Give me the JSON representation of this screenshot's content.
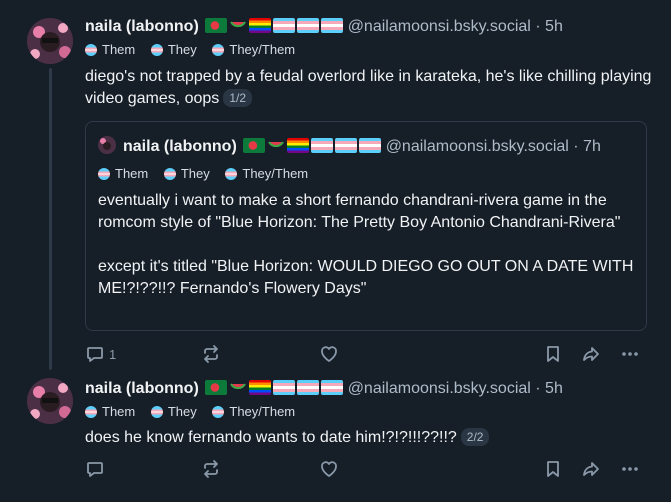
{
  "posts": [
    {
      "author_name": "naila (labonno)",
      "handle": "@nailamoonsi.bsky.social",
      "time": "· 5h",
      "pronouns": [
        "Them",
        "They",
        "They/Them"
      ],
      "text": "diego's not trapped by a feudal overlord like in karateka, he's like chilling playing video games, oops",
      "thread_badge": "1/2",
      "quote": {
        "author_name": "naila (labonno)",
        "handle": "@nailamoonsi.bsky.social",
        "time": "· 7h",
        "pronouns": [
          "Them",
          "They",
          "They/Them"
        ],
        "text_p1": "eventually i want to make a short fernando chandrani-rivera game in the romcom style of \"Blue Horizon: The Pretty Boy Antonio Chandrani-Rivera\"",
        "text_p2": "except it's titled \"Blue Horizon: WOULD DIEGO GO OUT ON A DATE WITH ME!?!??!!? Fernando's Flowery Days\""
      },
      "reply_count": "1"
    },
    {
      "author_name": "naila (labonno)",
      "handle": "@nailamoonsi.bsky.social",
      "time": "· 5h",
      "pronouns": [
        "Them",
        "They",
        "They/Them"
      ],
      "text": "does he know fernando wants to date him!?!?!!!??!!?",
      "thread_badge": "2/2",
      "reply_count": ""
    }
  ],
  "icons": [
    "reply-icon",
    "repost-icon",
    "like-icon",
    "bookmark-icon",
    "share-icon",
    "more-icon"
  ],
  "colors": {
    "background": "#161e27",
    "muted": "#8a99a9",
    "handle": "#aebbc9"
  }
}
